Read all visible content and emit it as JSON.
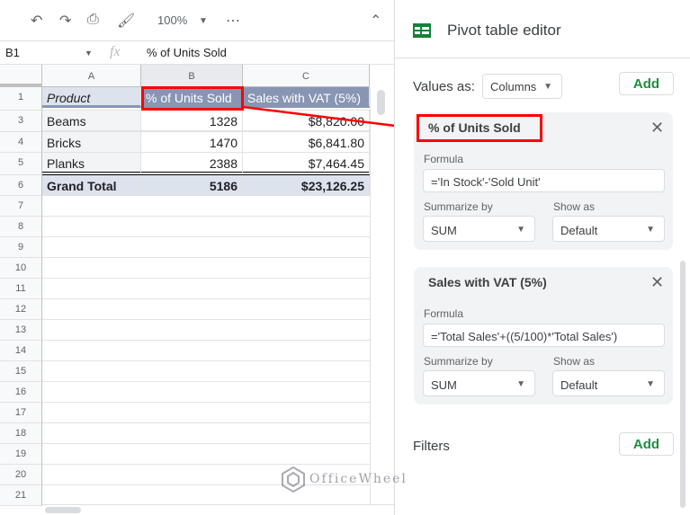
{
  "toolbar": {
    "zoom": "100%",
    "more": "⋯",
    "collapse": "⌃"
  },
  "formula_bar": {
    "cell_ref": "B1",
    "fx": "fx",
    "value": "% of Units Sold"
  },
  "sheet": {
    "columns": [
      "A",
      "B",
      "C"
    ],
    "row_numbers": [
      "1",
      "3",
      "4",
      "5",
      "6",
      "7",
      "8",
      "9",
      "10",
      "11",
      "12",
      "13",
      "14",
      "15",
      "16",
      "17",
      "18",
      "19",
      "20",
      "21"
    ],
    "header": [
      "Product",
      "% of Units Sold",
      "Sales with VAT (5%)"
    ],
    "rows": [
      [
        "Beams",
        "1328",
        "$8,820.00"
      ],
      [
        "Bricks",
        "1470",
        "$6,841.80"
      ],
      [
        "Planks",
        "2388",
        "$7,464.45"
      ]
    ],
    "total": [
      "Grand Total",
      "5186",
      "$23,126.25"
    ]
  },
  "panel": {
    "title": "Pivot table editor",
    "values_as_label": "Values as:",
    "values_as": "Columns",
    "add_label": "Add",
    "cards": [
      {
        "title": "% of Units Sold",
        "formula_label": "Formula",
        "formula": "='In Stock'-'Sold Unit'",
        "summarize_label": "Summarize by",
        "summarize": "SUM",
        "show_as_label": "Show as",
        "show_as": "Default"
      },
      {
        "title": "Sales with VAT (5%)",
        "formula_label": "Formula",
        "formula": "='Total Sales'+((5/100)*'Total Sales')",
        "summarize_label": "Summarize by",
        "summarize": "SUM",
        "show_as_label": "Show as",
        "show_as": "Default"
      }
    ],
    "filters_label": "Filters",
    "filters_add": "Add"
  },
  "watermark": "OfficeWheel",
  "colors": {
    "header_fill": "#8895b3",
    "total_fill": "#dde3ec",
    "highlight": "#ff0000",
    "accent": "#1e8e3e"
  }
}
